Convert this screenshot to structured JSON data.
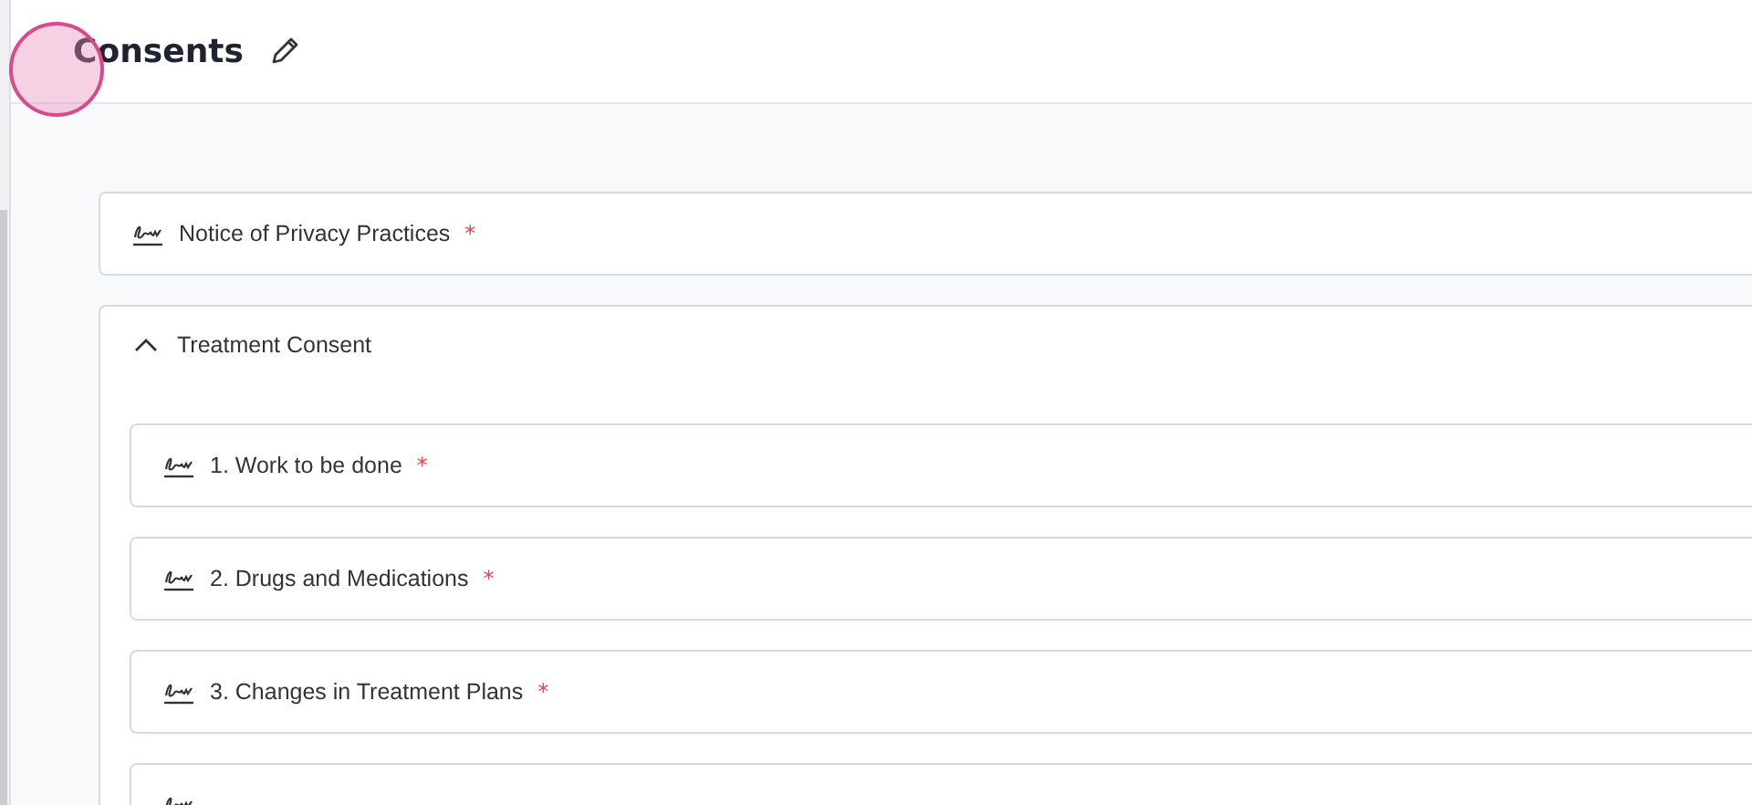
{
  "page": {
    "title": "Consents"
  },
  "consents": [
    {
      "kind": "form",
      "label": "Notice of Privacy Practices",
      "required_mark": "*"
    },
    {
      "kind": "group",
      "label": "Treatment Consent",
      "expanded": true,
      "children": [
        {
          "kind": "form",
          "label": "1. Work to be done",
          "required_mark": "*"
        },
        {
          "kind": "form",
          "label": "2. Drugs and Medications",
          "required_mark": "*"
        },
        {
          "kind": "form",
          "label": "3. Changes in Treatment Plans",
          "required_mark": "*"
        },
        {
          "kind": "form"
        }
      ]
    }
  ]
}
